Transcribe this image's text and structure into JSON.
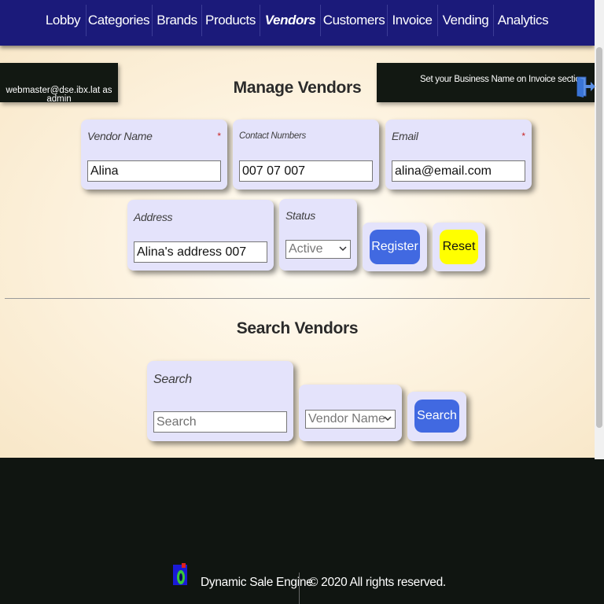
{
  "nav": {
    "items": [
      {
        "label": "Lobby"
      },
      {
        "label": "Categories"
      },
      {
        "label": "Brands"
      },
      {
        "label": "Products"
      },
      {
        "label": "Vendors"
      },
      {
        "label": "Customers"
      },
      {
        "label": "Invoice"
      },
      {
        "label": "Vending"
      },
      {
        "label": "Analytics"
      }
    ],
    "active": "Vendors"
  },
  "user_box": {
    "line1": "webmaster@dse.ibx.lat as",
    "line2": "admin"
  },
  "business_notice": "Set your Business Name on Invoice section",
  "icons": {
    "logout": "exit-door-icon",
    "brand": "dse-logo-icon"
  },
  "manage": {
    "title": "Manage Vendors",
    "vendor_name": {
      "label": "Vendor Name",
      "required": "*",
      "value": "Alina"
    },
    "contact_numbers": {
      "label": "Contact Numbers",
      "value": "007 07 007"
    },
    "email": {
      "label": "Email",
      "required": "*",
      "value": "alina@email.com"
    },
    "address": {
      "label": "Address",
      "value": "Alina's address 007"
    },
    "status": {
      "label": "Status",
      "selected": "Active"
    },
    "register_label": "Register",
    "reset_label": "Reset"
  },
  "search": {
    "title": "Search Vendors",
    "label": "Search",
    "placeholder": "Search",
    "filter_selected": "Vendor Name",
    "button_label": "Search"
  },
  "footer": {
    "brand": "Dynamic Sale Engine",
    "copyright": "© 2020 All rights reserved."
  },
  "colors": {
    "nav_bg": "#1b1a7a",
    "card_bg": "#e4e3fb",
    "primary_button": "#4169e1",
    "reset_button": "#ffff00",
    "footer_bg": "#101511"
  }
}
